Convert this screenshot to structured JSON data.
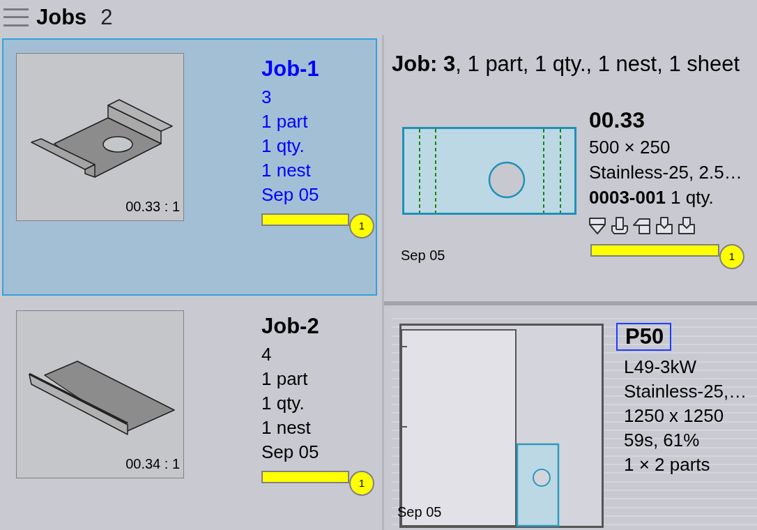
{
  "header": {
    "title": "Jobs",
    "count": "2"
  },
  "jobs": [
    {
      "name": "Job-1",
      "selected": true,
      "thumbnail": {
        "kind": "bracket",
        "caption": "00.33 : 1"
      },
      "number": "3",
      "parts": "1 part",
      "quantity": "1 qty.",
      "nests": "1 nest",
      "date": "Sep 05",
      "progress": {
        "level": 1,
        "badge": "1"
      }
    },
    {
      "name": "Job-2",
      "selected": false,
      "thumbnail": {
        "kind": "plate",
        "caption": "00.34 : 1"
      },
      "number": "4",
      "parts": "1 part",
      "quantity": "1 qty.",
      "nests": "1 nest",
      "date": "Sep 05",
      "progress": {
        "level": 1,
        "badge": "1"
      }
    }
  ],
  "summary": "**Job: 3**, 1 part, 1 qty., 1 nest, 1 sheet",
  "part": {
    "name": "00.33",
    "size": "500 × 250",
    "material": "Stainless-25, 2.5…",
    "order": "**0003-001** 1 qty.",
    "date": "Sep 05",
    "progress": {
      "level": 1,
      "badge": "1"
    }
  },
  "nest": {
    "name": "P50",
    "selected": true,
    "machine": "L49-3kW",
    "material": "Stainless-25,…",
    "sheet_size": "1250 x 1250",
    "time_usage": "59s, 61%",
    "parts": "1 × 2 parts",
    "date": "Sep 05"
  }
}
